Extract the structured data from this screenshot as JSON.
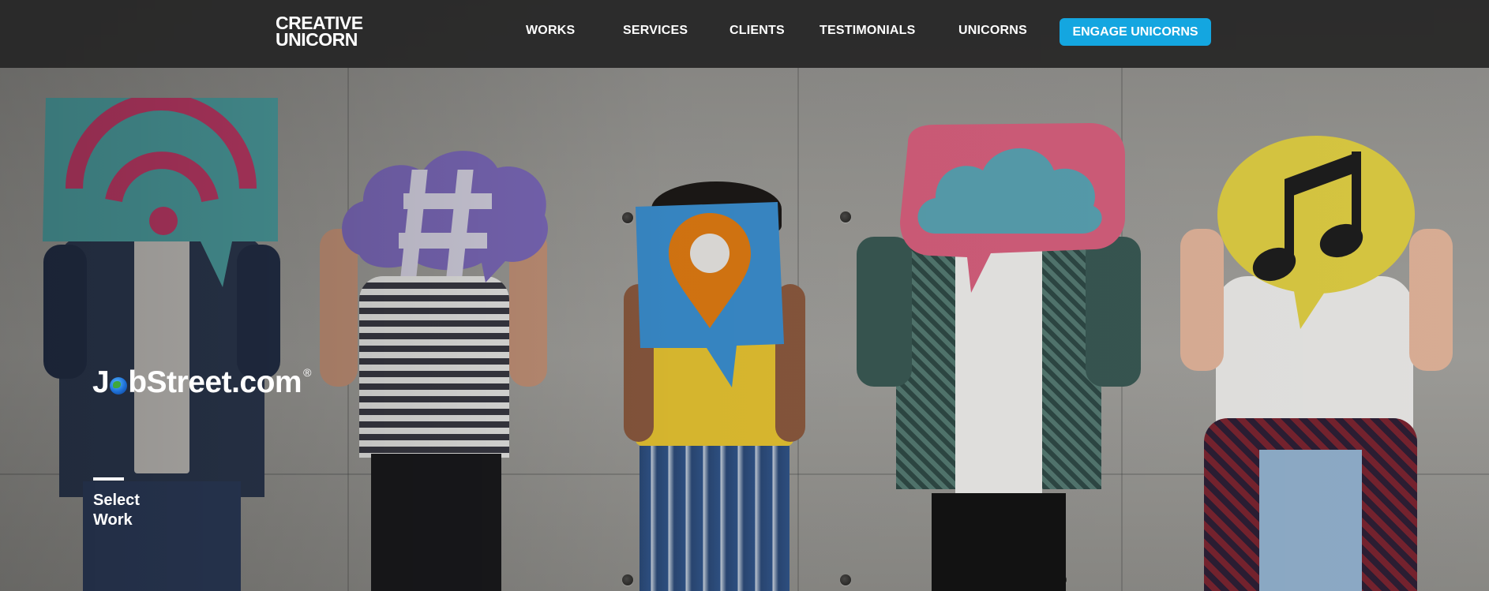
{
  "brand": {
    "logo_line1": "CREATIVE",
    "logo_line2": "UNICORN"
  },
  "nav": {
    "items": [
      {
        "label": "WORKS"
      },
      {
        "label": "SERVICES"
      },
      {
        "label": "CLIENTS"
      },
      {
        "label": "TESTIMONIALS"
      },
      {
        "label": "UNICORNS"
      }
    ],
    "cta_label": "ENGAGE UNICORNS"
  },
  "hero": {
    "client_logo_part1": "J",
    "client_logo_part2": "bStreet.com",
    "client_logo_mark": "®",
    "select_work_label": "Select Work",
    "signs": [
      "wifi-icon",
      "hashtag-icon",
      "location-pin-icon",
      "cloud-icon",
      "music-note-icon"
    ]
  },
  "colors": {
    "nav_bg": "#262626",
    "cta_bg": "#14a6e0",
    "wifi_sign": "#4fa3a5",
    "wifi_symbol": "#c43c6a",
    "hashtag_sign": "#7e6bbd",
    "pin_sign": "#3b8fd0",
    "pin_color": "#e07b12",
    "cloud_sign": "#d8607e",
    "cloud_color": "#5aa3b3",
    "music_sign": "#e0cf44"
  }
}
